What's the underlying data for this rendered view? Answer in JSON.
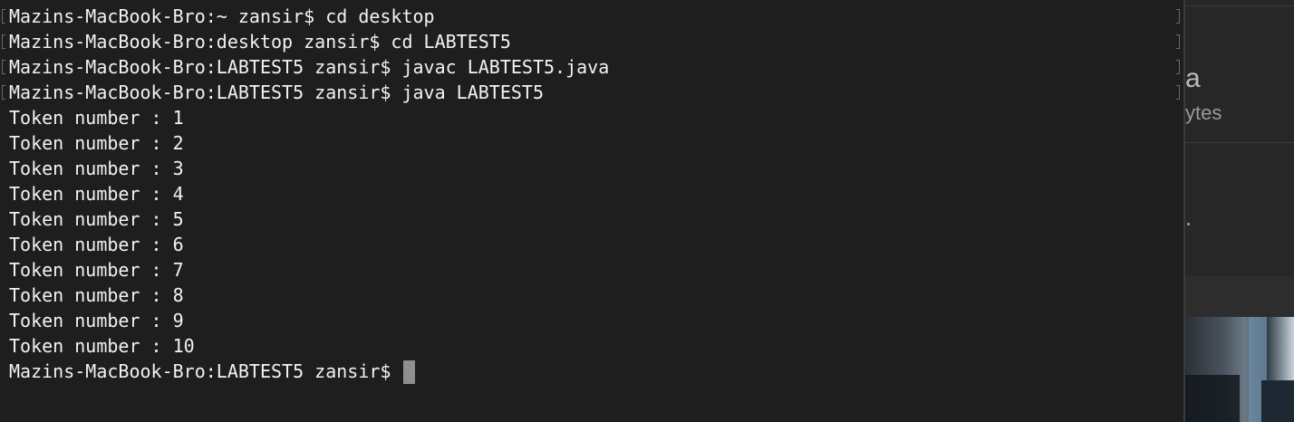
{
  "terminal": {
    "prompt_lines": [
      "Mazins-MacBook-Bro:~ zansir$ cd desktop",
      "Mazins-MacBook-Bro:desktop zansir$ cd LABTEST5",
      "Mazins-MacBook-Bro:LABTEST5 zansir$ javac LABTEST5.java",
      "Mazins-MacBook-Bro:LABTEST5 zansir$ java LABTEST5"
    ],
    "output_lines": [
      "Token number : 1",
      "Token number : 2",
      "Token number : 3",
      "Token number : 4",
      "Token number : 5",
      "Token number : 6",
      "Token number : 7",
      "Token number : 8",
      "Token number : 9",
      "Token number : 10"
    ],
    "current_prompt": "Mazins-MacBook-Bro:LABTEST5 zansir$ ",
    "colors": {
      "background": "#1e1e1e",
      "text": "#f2f2f2",
      "cursor": "#8f8f8f"
    }
  },
  "background_window": {
    "partial_text_1": "a",
    "partial_text_2": "ytes"
  }
}
